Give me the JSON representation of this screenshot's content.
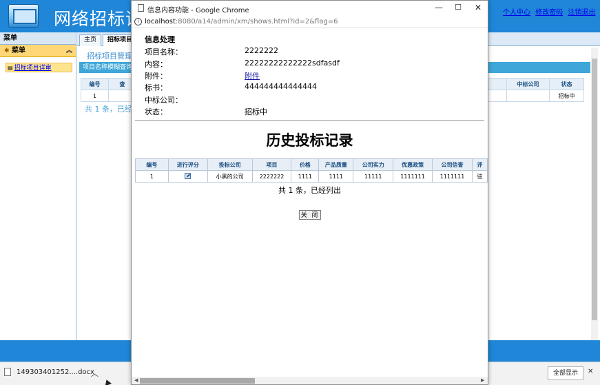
{
  "app": {
    "title": "网络招标评",
    "top_links": [
      "个人中心",
      "修改密码",
      "注销退出"
    ]
  },
  "sidebar": {
    "title": "菜单",
    "menu_header": "菜单",
    "menu_item": "招标项目详审"
  },
  "main": {
    "tabs": [
      "主页",
      "招标项目详"
    ],
    "section_title": "招标项目管理",
    "search_label": "项目名称模糊查询:",
    "bg_table": {
      "head": [
        "编号",
        "查",
        "",
        "中标公司",
        "状态"
      ],
      "row": [
        "1",
        "",
        "",
        "",
        "招标中"
      ]
    },
    "bg_pager": "共 1 条，已经"
  },
  "download_bar": {
    "file_name": "149303401252....docx",
    "show_all_label": "全部显示"
  },
  "popup": {
    "window_title": "信息内容功能 - Google Chrome",
    "url_host": "localhost",
    "url_path": ":8080/a14/admin/xm/shows.html?id=2&flag=6",
    "info_heading": "信息处理",
    "fields": {
      "name_label": "项目名称：",
      "name_value": "2222222",
      "content_label": "内容：",
      "content_value": "22222222222222sdfasdf",
      "attachment_label": "附件：",
      "attachment_link": "附件",
      "bidbook_label": "标书：",
      "bidbook_value": "444444444444444",
      "winner_label": "中标公司：",
      "winner_value": "",
      "status_label": "状态：",
      "status_value": "招标中"
    },
    "history_title": "历史投标记录",
    "bid_table": {
      "headers": [
        "编号",
        "进行评分",
        "投标公司",
        "项目",
        "价格",
        "产品质量",
        "公司实力",
        "优惠政策",
        "公司信誉",
        "评"
      ],
      "rows": [
        {
          "id": "1",
          "company": "小黑的公司",
          "project": "2222222",
          "price": "1111",
          "quality": "1111",
          "strength": "11111",
          "policy": "1111111",
          "reputation": "1111111",
          "rating": "驻"
        }
      ]
    },
    "pager": "共 1 条，已经列出",
    "close_label": "关 闭"
  }
}
